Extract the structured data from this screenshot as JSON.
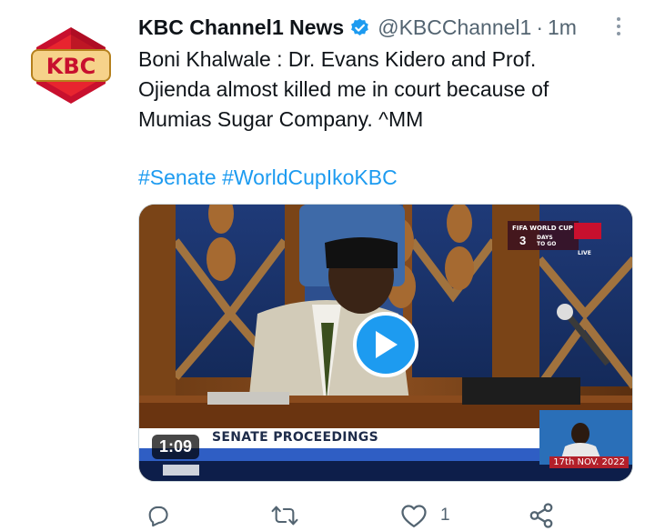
{
  "tweet": {
    "display_name": "KBC Channel1 News",
    "handle": "@KBCChannel1",
    "separator": "·",
    "timestamp": "1m",
    "verified": true,
    "text_lines": [
      "Boni Khalwale : Dr. Evans Kidero and Prof.",
      "Ojienda almost killed me in court because of",
      "Mumias Sugar Company. ^MM"
    ],
    "hashtags": [
      "#Senate",
      "#WorldCupIkoKBC"
    ]
  },
  "avatar": {
    "logo_text": "KBC"
  },
  "media": {
    "type": "video",
    "duration": "1:09",
    "overlay_caption": "SENATE PROCEEDINGS",
    "date_bug": "17th NOV. 2022",
    "countdown": {
      "label": "FIFA WORLD CUP",
      "days": "3",
      "days_label_1": "DAYS",
      "days_label_2": "TO GO"
    },
    "channel_bug": "LIVE"
  },
  "actions": {
    "reply": {
      "icon": "reply-icon",
      "count": ""
    },
    "retweet": {
      "icon": "retweet-icon",
      "count": ""
    },
    "like": {
      "icon": "heart-icon",
      "count": "1"
    },
    "share": {
      "icon": "share-icon",
      "count": ""
    }
  },
  "colors": {
    "link": "#1d9bf0",
    "secondary_text": "#536471",
    "kbc_red": "#c8102e"
  }
}
